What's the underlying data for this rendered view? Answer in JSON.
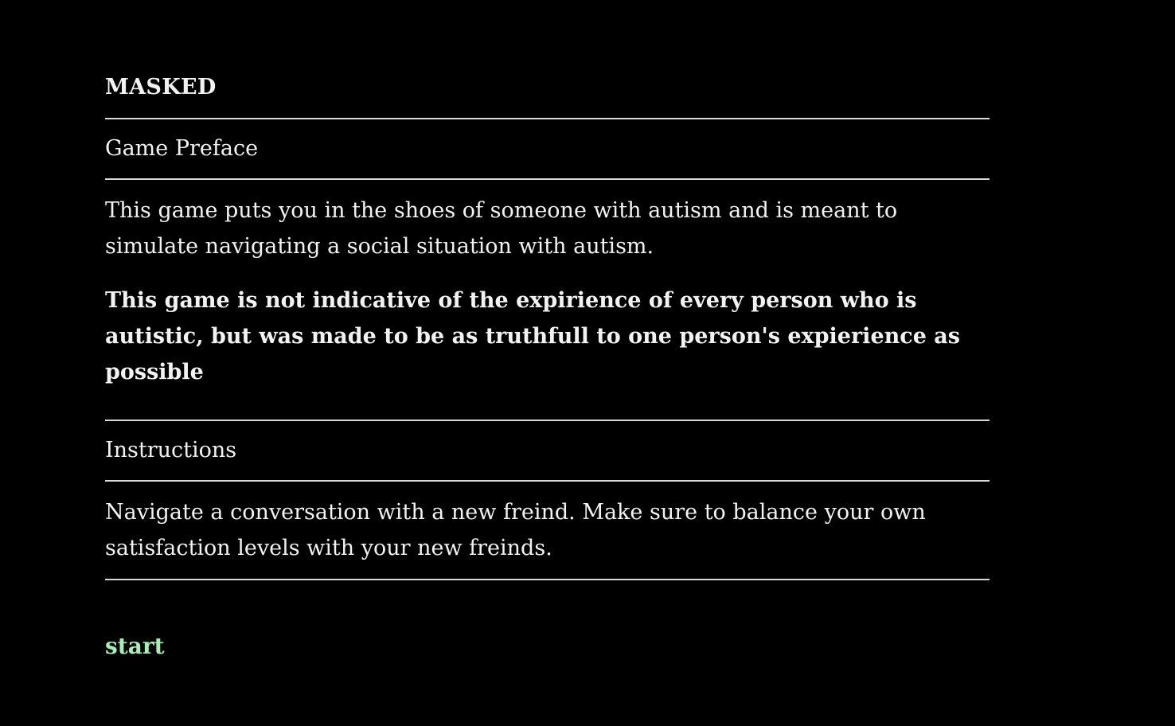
{
  "game": {
    "title": "MASKED"
  },
  "preface": {
    "heading": "Game Preface",
    "description": "This game puts you in the shoes of someone with autism and is meant to simulate navigating a social situation with autism.",
    "disclaimer": "This game is not indicative of the expirience of every person who is autistic, but was made to be as truthfull to one person's expierience as possible"
  },
  "instructions": {
    "heading": "Instructions",
    "body": "Navigate a conversation with a new freind. Make sure to balance your own satisfaction levels with your new freinds."
  },
  "actions": {
    "start_label": "start"
  },
  "colors": {
    "background": "#000000",
    "text": "#f2f2f2",
    "link": "#a8edb6",
    "rule": "#d9d9d9"
  }
}
